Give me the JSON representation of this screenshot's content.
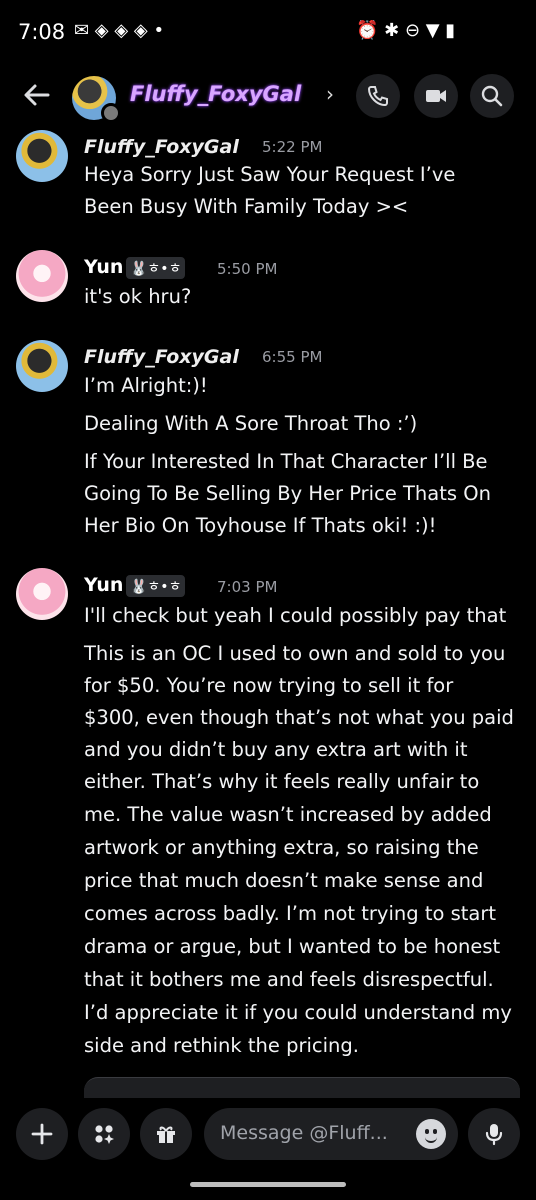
{
  "status_bar": {
    "time": "7:08",
    "notif_icons": "✉ ◈ ◈ ◈ •",
    "sys_icons": "⏰ ✱ ⊖ ▼ ▮"
  },
  "header": {
    "title": "Fluffy_FoxyGal",
    "chevron": "›"
  },
  "messages": [
    {
      "author": "Fluffy_FoxyGal",
      "time": "5:22 PM",
      "lines": [
        "Heya Sorry Just Saw Your Request I’ve",
        "Been Busy With Family Today ><"
      ]
    },
    {
      "author": "Yun",
      "badge": "🐰ㅎ•ㅎ",
      "time": "5:50 PM",
      "lines": [
        "it's ok hru?"
      ]
    },
    {
      "author": "Fluffy_FoxyGal",
      "time": "6:55 PM",
      "lines": [
        "I’m Alright:)!",
        "Dealing With A Sore Throat Tho :’)",
        "If Your Interested In That Character I’ll Be",
        "Going To Be Selling By Her Price Thats On",
        "Her Bio On Toyhouse If Thats oki! :)!"
      ]
    },
    {
      "author": "Yun",
      "badge": "🐰ㅎ•ㅎ",
      "time": "7:03 PM",
      "lines": [
        "I'll check but yeah I could possibly pay that",
        "This is an OC I used to own and sold to you",
        "for $50. You’re now trying to sell it for",
        "$300, even though that’s not what you paid",
        "and you didn’t buy any extra art with it",
        "either. That’s why it feels really unfair to",
        "me. The value wasn’t increased by added",
        "artwork or anything extra, so raising the",
        "price that much doesn’t make sense and",
        "comes across badly. I’m not trying to start",
        "drama or argue, but I wanted to be honest",
        "that it bothers me and feels disrespectful.",
        "I’d appreciate it if you could understand my",
        "side and rethink the pricing."
      ]
    }
  ],
  "composer": {
    "placeholder": "Message @Fluff..."
  }
}
